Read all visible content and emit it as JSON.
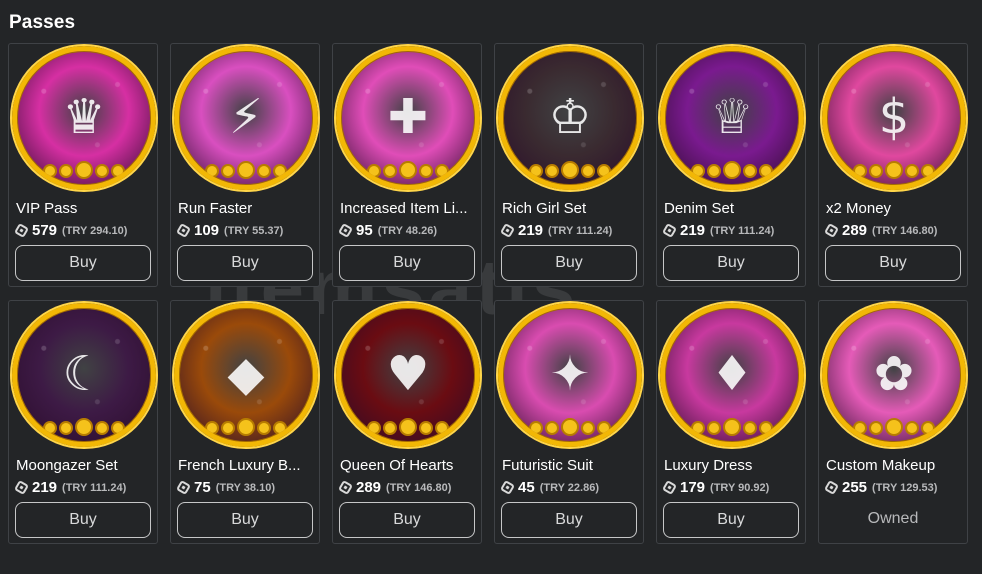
{
  "section_title": "Passes",
  "watermark": "itemsatis",
  "items": [
    {
      "name": "VIP Pass",
      "price": "579",
      "local": "(TRY 294.10)",
      "action": "Buy",
      "icon": "vip-crown-icon",
      "glyph": "♛",
      "bg": "#d62fa3"
    },
    {
      "name": "Run Faster",
      "price": "109",
      "local": "(TRY 55.37)",
      "action": "Buy",
      "icon": "high-heel-shoe-icon",
      "glyph": "⚡",
      "bg": "#d94fc0"
    },
    {
      "name": "Increased Item Li...",
      "price": "95",
      "local": "(TRY 48.26)",
      "action": "Buy",
      "icon": "clothing-plus-icon",
      "glyph": "✚",
      "bg": "#e04db8"
    },
    {
      "name": "Rich Girl Set",
      "price": "219",
      "local": "(TRY 111.24)",
      "action": "Buy",
      "icon": "rich-girl-avatar-icon",
      "glyph": "♔",
      "bg": "#3a2a30"
    },
    {
      "name": "Denim Set",
      "price": "219",
      "local": "(TRY 111.24)",
      "action": "Buy",
      "icon": "denim-avatar-icon",
      "glyph": "♕",
      "bg": "#7a1a8f"
    },
    {
      "name": "x2 Money",
      "price": "289",
      "local": "(TRY 146.80)",
      "action": "Buy",
      "icon": "money-bills-icon",
      "glyph": "$",
      "bg": "#e0489f"
    },
    {
      "name": "Moongazer Set",
      "price": "219",
      "local": "(TRY 111.24)",
      "action": "Buy",
      "icon": "moongazer-avatar-icon",
      "glyph": "☾",
      "bg": "#3d1a45"
    },
    {
      "name": "French Luxury B...",
      "price": "75",
      "local": "(TRY 38.10)",
      "action": "Buy",
      "icon": "luxury-bag-icon",
      "glyph": "◆",
      "bg": "#9a4a0a"
    },
    {
      "name": "Queen Of Hearts",
      "price": "289",
      "local": "(TRY 146.80)",
      "action": "Buy",
      "icon": "queen-hearts-avatar-icon",
      "glyph": "♥",
      "bg": "#6a0c12"
    },
    {
      "name": "Futuristic Suit",
      "price": "45",
      "local": "(TRY 22.86)",
      "action": "Buy",
      "icon": "futuristic-suit-icon",
      "glyph": "✦",
      "bg": "#d94cb0"
    },
    {
      "name": "Luxury Dress",
      "price": "179",
      "local": "(TRY 90.92)",
      "action": "Buy",
      "icon": "luxury-dress-icon",
      "glyph": "♦",
      "bg": "#c8399f"
    },
    {
      "name": "Custom Makeup",
      "price": "255",
      "local": "(TRY 129.53)",
      "action": "Owned",
      "icon": "makeup-face-icon",
      "glyph": "✿",
      "bg": "#e55bb8"
    }
  ]
}
